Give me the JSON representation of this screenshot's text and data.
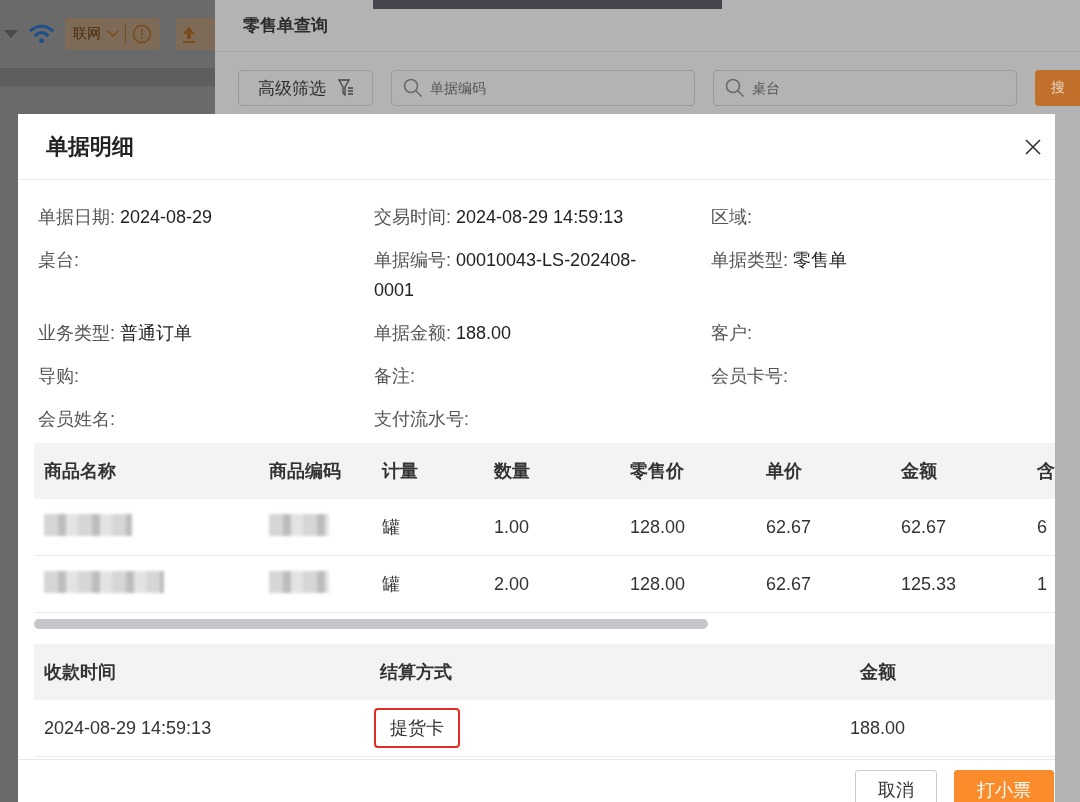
{
  "background_app": {
    "network_status": "联网"
  },
  "query_panel": {
    "title": "零售单查询",
    "filter_button": "高级筛选",
    "code_search": {
      "placeholder": "单据编码"
    },
    "table_search": {
      "placeholder": "桌台"
    },
    "search_button": "搜"
  },
  "dialog": {
    "title": "单据明细",
    "fields": [
      {
        "label": "单据日期:",
        "value": "2024-08-29"
      },
      {
        "label": "交易时间:",
        "value": "2024-08-29 14:59:13"
      },
      {
        "label": "区域:"
      },
      {
        "label": "桌台:"
      },
      {
        "label": "单据编号:",
        "value": "00010043-LS-202408-0001"
      },
      {
        "label": "单据类型:",
        "value": "零售单"
      },
      {
        "label": "业务类型:",
        "value": "普通订单"
      },
      {
        "label": "单据金额:",
        "value": "188.00"
      },
      {
        "label": "客户:"
      },
      {
        "label": "导购:"
      },
      {
        "label": "备注:"
      },
      {
        "label": "会员卡号:"
      },
      {
        "label": "会员姓名:"
      },
      {
        "label": "支付流水号:"
      }
    ],
    "items_table": {
      "columns": [
        "商品名称",
        "商品编码",
        "计量",
        "数量",
        "零售价",
        "单价",
        "金额",
        "含"
      ],
      "rows": [
        {
          "cells": [
            null,
            null,
            "罐",
            "1.00",
            "128.00",
            "62.67",
            "62.67",
            "6"
          ]
        },
        {
          "cells": [
            null,
            null,
            "罐",
            "2.00",
            "128.00",
            "62.67",
            "125.33",
            "1"
          ]
        }
      ]
    },
    "payments_table": {
      "columns": [
        "收款时间",
        "结算方式",
        "金额"
      ],
      "rows": [
        {
          "time": "2024-08-29 14:59:13",
          "method": "提货卡",
          "method_highlighted": true,
          "amount": "188.00"
        }
      ]
    },
    "buttons": [
      {
        "label": "取消",
        "kind": "secondary"
      },
      {
        "label": "打小票",
        "kind": "primary"
      }
    ]
  }
}
